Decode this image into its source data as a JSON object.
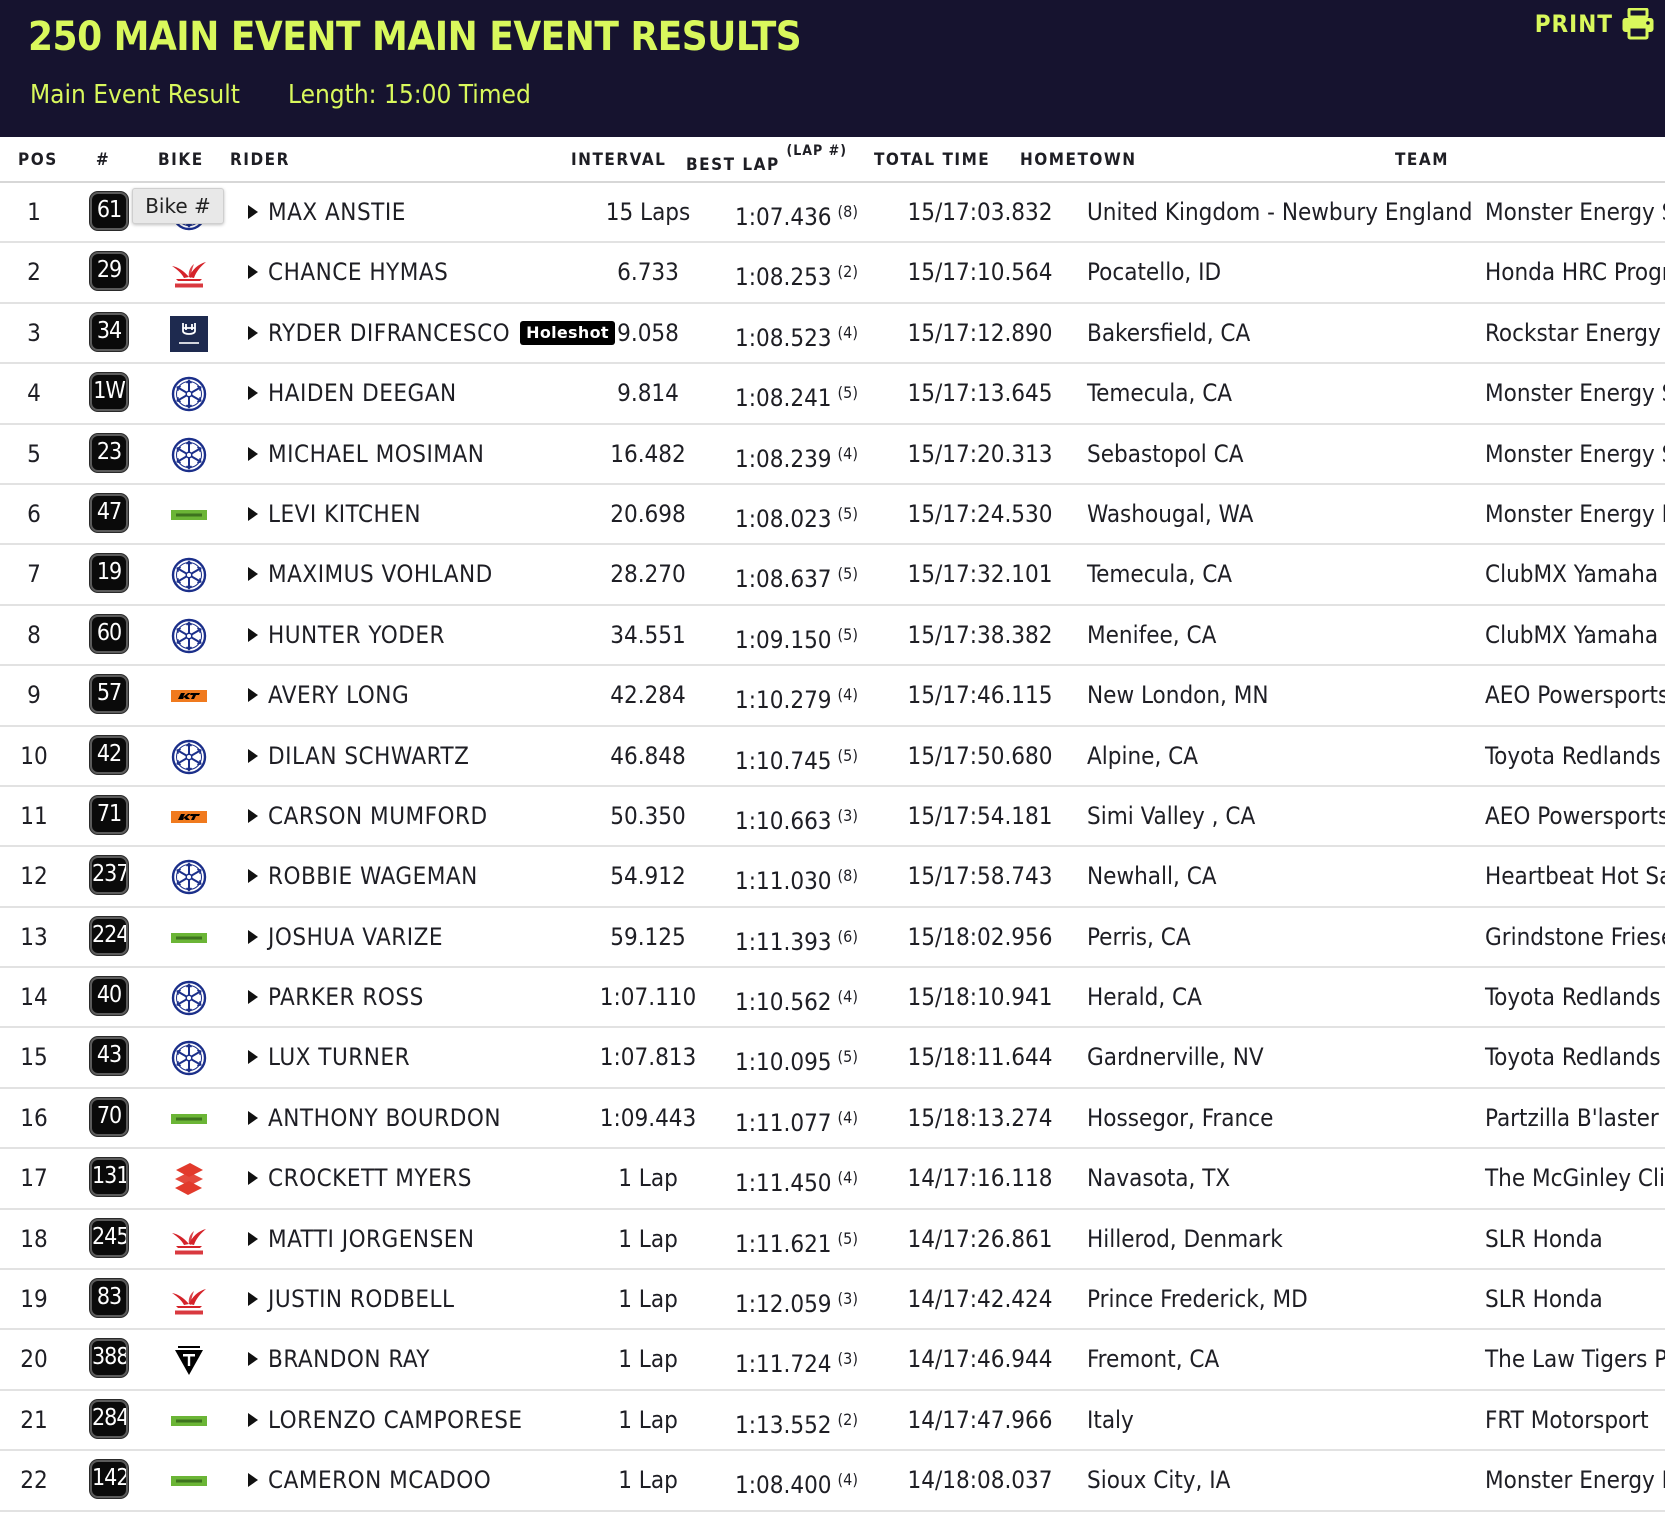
{
  "header": {
    "title": "250 MAIN EVENT MAIN EVENT RESULTS",
    "result_label": "Main Event Result",
    "length_label": "Length: 15:00 Timed",
    "print_label": "PRINT"
  },
  "columns": {
    "pos": "POS",
    "number": "#",
    "bike": "BIKE",
    "rider": "RIDER",
    "interval": "INTERVAL",
    "best_lap": "BEST LAP",
    "best_lap_sup": "(LAP #)",
    "total_time": "TOTAL TIME",
    "hometown": "HOMETOWN",
    "team": "TEAM"
  },
  "tooltip": {
    "text": "Bike #"
  },
  "colors": {
    "header_bg": "#16132f",
    "accent": "#d9f85c",
    "yamaha": "#1b2f8a",
    "honda": "#d5232a",
    "husqvarna": "#1e2a4f",
    "kawasaki": "#6bb536",
    "ktm": "#f07a1e",
    "suzuki": "#e23a2c",
    "triumph": "#000000"
  },
  "rows": [
    {
      "pos": "1",
      "num": "61",
      "brand": "yamaha",
      "rider": "MAX ANSTIE",
      "holeshot": "",
      "interval": "15 Laps",
      "best_lap": "1:07.436",
      "lap_no": "(8)",
      "total": "15/17:03.832",
      "hometown": "United Kingdom - Newbury England",
      "team": "Monster Energy St"
    },
    {
      "pos": "2",
      "num": "29",
      "brand": "honda",
      "rider": "CHANCE HYMAS",
      "holeshot": "",
      "interval": "6.733",
      "best_lap": "1:08.253",
      "lap_no": "(2)",
      "total": "15/17:10.564",
      "hometown": "Pocatello, ID",
      "team": "Honda HRC Progre"
    },
    {
      "pos": "3",
      "num": "34",
      "brand": "husqvarna",
      "rider": "RYDER DIFRANCESCO",
      "holeshot": "Holeshot",
      "interval": "9.058",
      "best_lap": "1:08.523",
      "lap_no": "(4)",
      "total": "15/17:12.890",
      "hometown": "Bakersfield, CA",
      "team": "Rockstar Energy H"
    },
    {
      "pos": "4",
      "num": "1W",
      "brand": "yamaha",
      "rider": "HAIDEN DEEGAN",
      "holeshot": "",
      "interval": "9.814",
      "best_lap": "1:08.241",
      "lap_no": "(5)",
      "total": "15/17:13.645",
      "hometown": "Temecula, CA",
      "team": "Monster Energy St"
    },
    {
      "pos": "5",
      "num": "23",
      "brand": "yamaha",
      "rider": "MICHAEL MOSIMAN",
      "holeshot": "",
      "interval": "16.482",
      "best_lap": "1:08.239",
      "lap_no": "(4)",
      "total": "15/17:20.313",
      "hometown": "Sebastopol CA",
      "team": "Monster Energy St"
    },
    {
      "pos": "6",
      "num": "47",
      "brand": "kawasaki",
      "rider": "LEVI KITCHEN",
      "holeshot": "",
      "interval": "20.698",
      "best_lap": "1:08.023",
      "lap_no": "(5)",
      "total": "15/17:24.530",
      "hometown": "Washougal, WA",
      "team": "Monster Energy P"
    },
    {
      "pos": "7",
      "num": "19",
      "brand": "yamaha",
      "rider": "MAXIMUS VOHLAND",
      "holeshot": "",
      "interval": "28.270",
      "best_lap": "1:08.637",
      "lap_no": "(5)",
      "total": "15/17:32.101",
      "hometown": "Temecula, CA",
      "team": "ClubMX Yamaha"
    },
    {
      "pos": "8",
      "num": "60",
      "brand": "yamaha",
      "rider": "HUNTER YODER",
      "holeshot": "",
      "interval": "34.551",
      "best_lap": "1:09.150",
      "lap_no": "(5)",
      "total": "15/17:38.382",
      "hometown": "Menifee, CA",
      "team": "ClubMX Yamaha"
    },
    {
      "pos": "9",
      "num": "57",
      "brand": "ktm",
      "rider": "AVERY LONG",
      "holeshot": "",
      "interval": "42.284",
      "best_lap": "1:10.279",
      "lap_no": "(4)",
      "total": "15/17:46.115",
      "hometown": "New London, MN",
      "team": "AEO Powersports"
    },
    {
      "pos": "10",
      "num": "42",
      "brand": "yamaha",
      "rider": "DILAN SCHWARTZ",
      "holeshot": "",
      "interval": "46.848",
      "best_lap": "1:10.745",
      "lap_no": "(5)",
      "total": "15/17:50.680",
      "hometown": "Alpine, CA",
      "team": "Toyota Redlands E"
    },
    {
      "pos": "11",
      "num": "71",
      "brand": "ktm",
      "rider": "CARSON MUMFORD",
      "holeshot": "",
      "interval": "50.350",
      "best_lap": "1:10.663",
      "lap_no": "(3)",
      "total": "15/17:54.181",
      "hometown": "Simi Valley , CA",
      "team": "AEO Powersports"
    },
    {
      "pos": "12",
      "num": "237",
      "brand": "yamaha",
      "rider": "ROBBIE WAGEMAN",
      "holeshot": "",
      "interval": "54.912",
      "best_lap": "1:11.030",
      "lap_no": "(8)",
      "total": "15/17:58.743",
      "hometown": "Newhall, CA",
      "team": "Heartbeat Hot Sau"
    },
    {
      "pos": "13",
      "num": "224",
      "brand": "kawasaki",
      "rider": "JOSHUA VARIZE",
      "holeshot": "",
      "interval": "59.125",
      "best_lap": "1:11.393",
      "lap_no": "(6)",
      "total": "15/18:02.956",
      "hometown": "Perris, CA",
      "team": "Grindstone Friese"
    },
    {
      "pos": "14",
      "num": "40",
      "brand": "yamaha",
      "rider": "PARKER ROSS",
      "holeshot": "",
      "interval": "1:07.110",
      "best_lap": "1:10.562",
      "lap_no": "(4)",
      "total": "15/18:10.941",
      "hometown": "Herald, CA",
      "team": "Toyota Redlands E"
    },
    {
      "pos": "15",
      "num": "43",
      "brand": "yamaha",
      "rider": "LUX TURNER",
      "holeshot": "",
      "interval": "1:07.813",
      "best_lap": "1:10.095",
      "lap_no": "(5)",
      "total": "15/18:11.644",
      "hometown": "Gardnerville, NV",
      "team": "Toyota Redlands E"
    },
    {
      "pos": "16",
      "num": "70",
      "brand": "kawasaki",
      "rider": "ANTHONY BOURDON",
      "holeshot": "",
      "interval": "1:09.443",
      "best_lap": "1:11.077",
      "lap_no": "(4)",
      "total": "15/18:13.274",
      "hometown": "Hossegor, France",
      "team": "Partzilla B'laster P"
    },
    {
      "pos": "17",
      "num": "131",
      "brand": "suzuki",
      "rider": "CROCKETT MYERS",
      "holeshot": "",
      "interval": "1 Lap",
      "best_lap": "1:11.450",
      "lap_no": "(4)",
      "total": "14/17:16.118",
      "hometown": "Navasota, TX",
      "team": "The McGinley Clin"
    },
    {
      "pos": "18",
      "num": "245",
      "brand": "honda",
      "rider": "MATTI JORGENSEN",
      "holeshot": "",
      "interval": "1 Lap",
      "best_lap": "1:11.621",
      "lap_no": "(5)",
      "total": "14/17:26.861",
      "hometown": "Hillerod, Denmark",
      "team": "SLR Honda"
    },
    {
      "pos": "19",
      "num": "83",
      "brand": "honda",
      "rider": "JUSTIN RODBELL",
      "holeshot": "",
      "interval": "1 Lap",
      "best_lap": "1:12.059",
      "lap_no": "(3)",
      "total": "14/17:42.424",
      "hometown": "Prince Frederick, MD",
      "team": "SLR Honda"
    },
    {
      "pos": "20",
      "num": "388",
      "brand": "triumph",
      "rider": "BRANDON RAY",
      "holeshot": "",
      "interval": "1 Lap",
      "best_lap": "1:11.724",
      "lap_no": "(3)",
      "total": "14/17:46.944",
      "hometown": "Fremont, CA",
      "team": "The Law Tigers Pr"
    },
    {
      "pos": "21",
      "num": "284",
      "brand": "kawasaki",
      "rider": "LORENZO CAMPORESE",
      "holeshot": "",
      "interval": "1 Lap",
      "best_lap": "1:13.552",
      "lap_no": "(2)",
      "total": "14/17:47.966",
      "hometown": "Italy",
      "team": "FRT Motorsport"
    },
    {
      "pos": "22",
      "num": "142",
      "brand": "kawasaki",
      "rider": "CAMERON MCADOO",
      "holeshot": "",
      "interval": "1 Lap",
      "best_lap": "1:08.400",
      "lap_no": "(4)",
      "total": "14/18:08.037",
      "hometown": "Sioux City, IA",
      "team": "Monster Energy P"
    }
  ]
}
